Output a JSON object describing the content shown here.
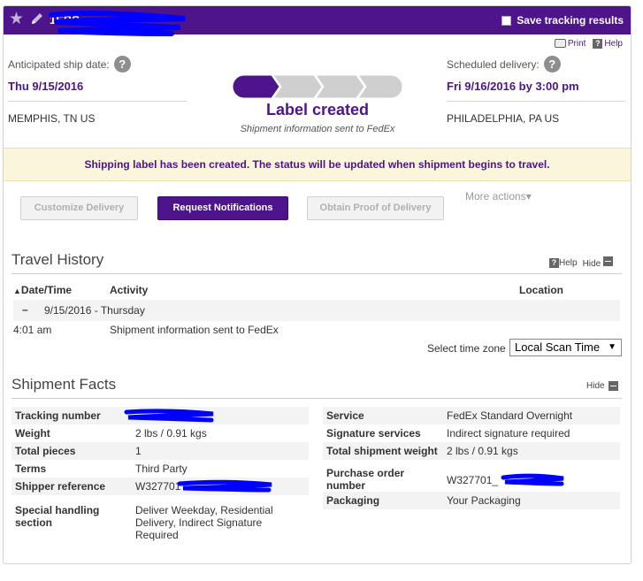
{
  "header": {
    "tracking_title": "1EBS",
    "save_label": "Save tracking results"
  },
  "util": {
    "print": "Print",
    "help": "Help"
  },
  "ship": {
    "anticipated_label": "Anticipated ship date:",
    "anticipated_date": "Thu 9/15/2016",
    "origin": "MEMPHIS, TN US",
    "scheduled_label": "Scheduled delivery:",
    "scheduled_date": "Fri 9/16/2016 by 3:00 pm",
    "destination": "PHILADELPHIA, PA US"
  },
  "status": {
    "title": "Label created",
    "subtitle": "Shipment information sent to FedEx",
    "progress_step": 1,
    "progress_total": 4
  },
  "banner": "Shipping label has been created. The status will be updated when shipment begins to travel.",
  "actions": {
    "customize": "Customize Delivery",
    "request": "Request Notifications",
    "proof": "Obtain Proof of Delivery",
    "more": "More actions"
  },
  "travel": {
    "title": "Travel History",
    "help": "Help",
    "hide": "Hide",
    "col_date": "Date/Time",
    "col_activity": "Activity",
    "col_location": "Location",
    "day_toggle": "–",
    "day": "9/15/2016 - Thursday",
    "events": [
      {
        "time": "4:01 am",
        "activity": "Shipment information sent to FedEx",
        "location": ""
      }
    ],
    "tz_label": "Select time zone",
    "tz_value": "Local Scan Time"
  },
  "facts": {
    "title": "Shipment Facts",
    "hide": "Hide",
    "left": [
      {
        "k": "Tracking number",
        "v": ""
      },
      {
        "k": "Weight",
        "v": "2 lbs / 0.91 kgs"
      },
      {
        "k": "Total pieces",
        "v": "1"
      },
      {
        "k": "Terms",
        "v": "Third Party"
      },
      {
        "k": "Shipper reference",
        "v": "W327701"
      },
      {
        "k": "Special handling section",
        "v": "Deliver Weekday, Residential Delivery, Indirect Signature Required"
      }
    ],
    "right": [
      {
        "k": "Service",
        "v": "FedEx Standard Overnight"
      },
      {
        "k": "Signature services",
        "v": "Indirect signature required"
      },
      {
        "k": "Total shipment weight",
        "v": "2 lbs / 0.91 kgs"
      },
      {
        "k": "Purchase order number",
        "v": "W327701_"
      },
      {
        "k": "Packaging",
        "v": "Your Packaging"
      }
    ]
  },
  "colors": {
    "brand_purple": "#4d148c",
    "banner_bg": "#fbf5dc",
    "scribble_blue": "#0000ff"
  }
}
